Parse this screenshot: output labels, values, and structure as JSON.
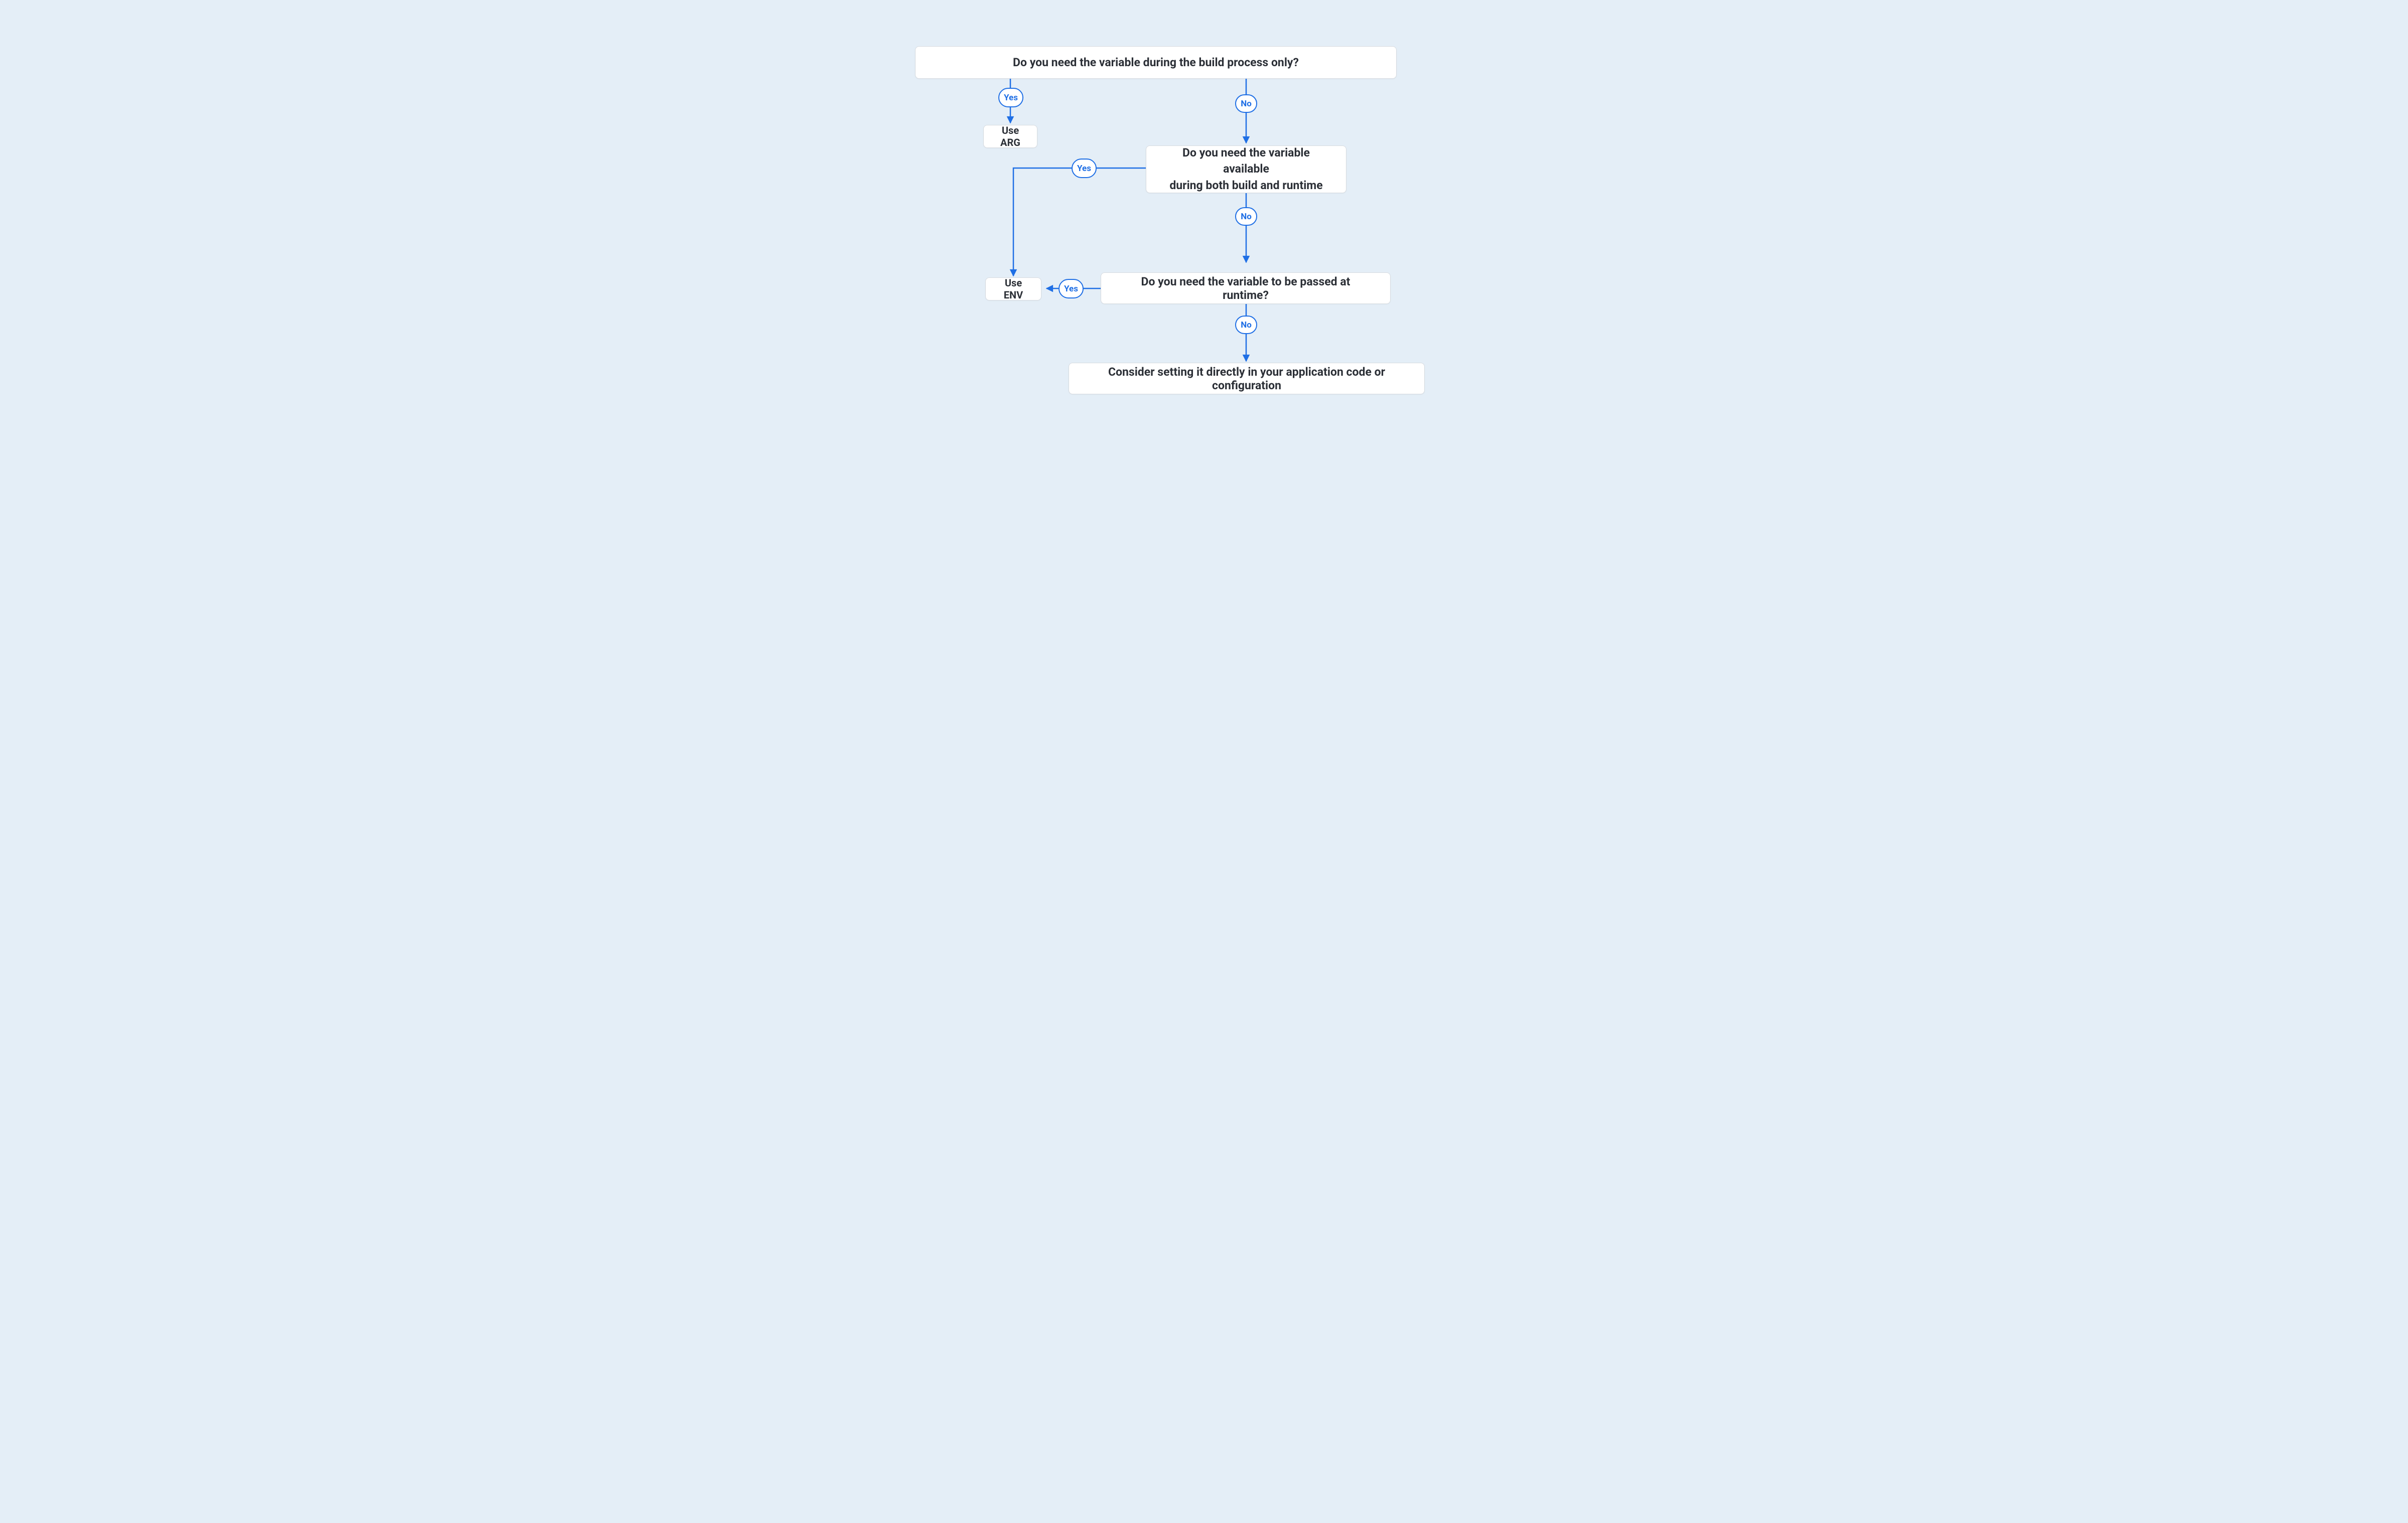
{
  "colors": {
    "bg": "#e4eef7",
    "nodeBg": "#ffffff",
    "nodeBorder": "#d7dbe0",
    "accent": "#1f6fe5",
    "text": "#2b2f36"
  },
  "nodes": {
    "q1": "Do you need the variable during the build process only?",
    "use_arg": "Use ARG",
    "q2_line1": "Do you need the variable available",
    "q2_line2": "during both build and runtime",
    "use_env": "Use ENV",
    "q3": "Do you need the variable to be passed at runtime?",
    "final": "Consider setting it directly in your application code or configuration"
  },
  "badges": {
    "yes": "Yes",
    "no": "No"
  },
  "diagram_semantics": {
    "decision_tree": [
      {
        "question": "Do you need the variable during the build process only?",
        "yes": "Use ARG",
        "no": {
          "question": "Do you need the variable available during both build and runtime",
          "yes": "Use ENV",
          "no": {
            "question": "Do you need the variable to be passed at runtime?",
            "yes": "Use ENV",
            "no": "Consider setting it directly in your application code or configuration"
          }
        }
      }
    ]
  }
}
